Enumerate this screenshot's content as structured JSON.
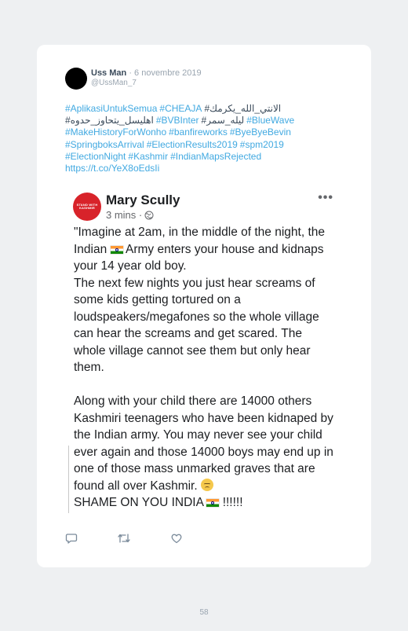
{
  "tweet": {
    "user_name": "Uss Man",
    "date": "· 6 novembre 2019",
    "handle": "@UssMan_7",
    "lines": [
      [
        {
          "t": "#AplikasiUntukSemua",
          "c": "link"
        },
        {
          "t": "#CHEAJA",
          "c": "link"
        },
        {
          "t": "#الانتي_الله_يكرمك",
          "c": "dark"
        }
      ],
      [
        {
          "t": "#اهليسل_يتحاوز_حدوه",
          "c": "dark"
        },
        {
          "t": "#BVBInter",
          "c": "link"
        },
        {
          "t": "#ليله_سمر",
          "c": "dark"
        },
        {
          "t": "#BlueWave",
          "c": "link"
        }
      ],
      [
        {
          "t": "#MakeHistoryForWonho",
          "c": "link"
        },
        {
          "t": "#banfireworks",
          "c": "link"
        },
        {
          "t": "#ByeByeBevin",
          "c": "link"
        }
      ],
      [
        {
          "t": "#SpringboksArrival",
          "c": "link"
        },
        {
          "t": "#ElectionResults2019",
          "c": "link"
        },
        {
          "t": "#spm2019",
          "c": "link"
        }
      ],
      [
        {
          "t": "#ElectionNight",
          "c": "link"
        },
        {
          "t": "#Kashmir",
          "c": "link"
        },
        {
          "t": "#IndianMapsRejected",
          "c": "link"
        }
      ],
      [
        {
          "t": "https://t.co/YeX8oEdsIi",
          "c": "link"
        }
      ]
    ]
  },
  "fb_post": {
    "author": "Mary Scully",
    "time": "3 mins ·",
    "logo_text": "STAND WITH KASHMIR",
    "more": "•••",
    "p1_a": "\"Imagine at 2am, in the middle of the night, the Indian ",
    "p1_b": " Army enters your house and kidnaps your 14 year old boy.",
    "p2": "The next few nights you just hear screams of some kids getting tortured on a loudspeakers/megafones so the whole village can hear the screams and get scared. The whole village cannot see them but only hear them.",
    "p3_a": "Along with your child there are 14000 others Kashmiri teenagers who have been kidnaped by the Indian army. You may never see your child ever again and those 14000 boys may end up in one of those mass unmarked graves that are found all over Kashmir. ",
    "p3_b": "SHAME ON YOU INDIA ",
    "p3_c": " !!!!!!"
  },
  "actions": [
    "reply-icon",
    "retweet-icon",
    "like-icon"
  ],
  "colors": {
    "link": "#41a9e1",
    "dark": "#3a4a5a",
    "muted": "#9aa5b0"
  },
  "page_number": "58"
}
